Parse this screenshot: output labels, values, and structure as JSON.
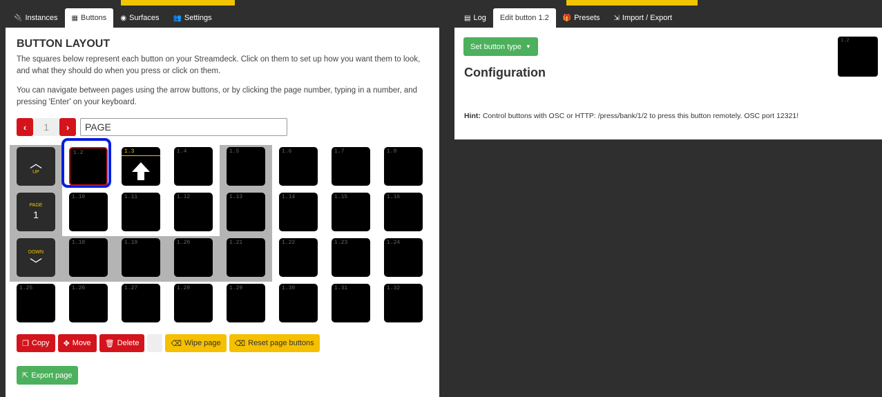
{
  "left_tabs": [
    {
      "icon": "plug-icon",
      "glyph": "🔌",
      "label": "Instances",
      "active": false
    },
    {
      "icon": "grid-icon",
      "glyph": "▦",
      "label": "Buttons",
      "active": true
    },
    {
      "icon": "gamepad-icon",
      "glyph": "◉",
      "label": "Surfaces",
      "active": false
    },
    {
      "icon": "users-icon",
      "glyph": "👥",
      "label": "Settings",
      "active": false
    }
  ],
  "right_tabs": [
    {
      "icon": "clipboard-icon",
      "glyph": "▤",
      "label": "Log",
      "active": false
    },
    {
      "icon": "",
      "glyph": "",
      "label": "Edit button 1.2",
      "active": true
    },
    {
      "icon": "gift-icon",
      "glyph": "🎁",
      "label": "Presets",
      "active": false
    },
    {
      "icon": "import-icon",
      "glyph": "⇲",
      "label": "Import / Export",
      "active": false
    }
  ],
  "layout": {
    "title": "BUTTON LAYOUT",
    "desc1": "The squares below represent each button on your Streamdeck. Click on them to set up how you want them to look, and what they should do when you press or click on them.",
    "desc2": "You can navigate between pages using the arrow buttons, or by clicking the page number, typing in a number, and pressing 'Enter' on your keyboard.",
    "prev": "‹",
    "next": "›",
    "page_number": "1",
    "page_name": "PAGE"
  },
  "nav": {
    "up_label": "UP",
    "page_label": "PAGE",
    "page_value": "1",
    "down_label": "DOWN"
  },
  "buttons": [
    {
      "id": "1.2",
      "col": 1,
      "row": 0,
      "selected": true
    },
    {
      "id": "1.3",
      "col": 2,
      "row": 0,
      "arrow": true
    },
    {
      "id": "1.4",
      "col": 3,
      "row": 0
    },
    {
      "id": "1.5",
      "col": 4,
      "row": 0
    },
    {
      "id": "1.6",
      "col": 5,
      "row": 0
    },
    {
      "id": "1.7",
      "col": 6,
      "row": 0
    },
    {
      "id": "1.8",
      "col": 7,
      "row": 0
    },
    {
      "id": "1.10",
      "col": 1,
      "row": 1
    },
    {
      "id": "1.11",
      "col": 2,
      "row": 1
    },
    {
      "id": "1.12",
      "col": 3,
      "row": 1
    },
    {
      "id": "1.13",
      "col": 4,
      "row": 1
    },
    {
      "id": "1.14",
      "col": 5,
      "row": 1
    },
    {
      "id": "1.15",
      "col": 6,
      "row": 1
    },
    {
      "id": "1.16",
      "col": 7,
      "row": 1
    },
    {
      "id": "1.18",
      "col": 1,
      "row": 2
    },
    {
      "id": "1.19",
      "col": 2,
      "row": 2
    },
    {
      "id": "1.20",
      "col": 3,
      "row": 2
    },
    {
      "id": "1.21",
      "col": 4,
      "row": 2
    },
    {
      "id": "1.22",
      "col": 5,
      "row": 2
    },
    {
      "id": "1.23",
      "col": 6,
      "row": 2
    },
    {
      "id": "1.24",
      "col": 7,
      "row": 2
    },
    {
      "id": "1.25",
      "col": 0,
      "row": 3
    },
    {
      "id": "1.26",
      "col": 1,
      "row": 3
    },
    {
      "id": "1.27",
      "col": 2,
      "row": 3
    },
    {
      "id": "1.28",
      "col": 3,
      "row": 3
    },
    {
      "id": "1.29",
      "col": 4,
      "row": 3
    },
    {
      "id": "1.30",
      "col": 5,
      "row": 3
    },
    {
      "id": "1.31",
      "col": 6,
      "row": 3
    },
    {
      "id": "1.32",
      "col": 7,
      "row": 3
    }
  ],
  "actions": {
    "copy": "Copy",
    "move": "Move",
    "delete": "Delete",
    "wipe": "Wipe page",
    "reset": "Reset page buttons",
    "export": "Export page"
  },
  "editor": {
    "set_type": "Set button type",
    "configuration": "Configuration",
    "hint_label": "Hint:",
    "hint_text": " Control buttons with OSC or HTTP: /press/bank/1/2 to press this button remotely. OSC port 12321!",
    "preview_label": "1.2"
  }
}
